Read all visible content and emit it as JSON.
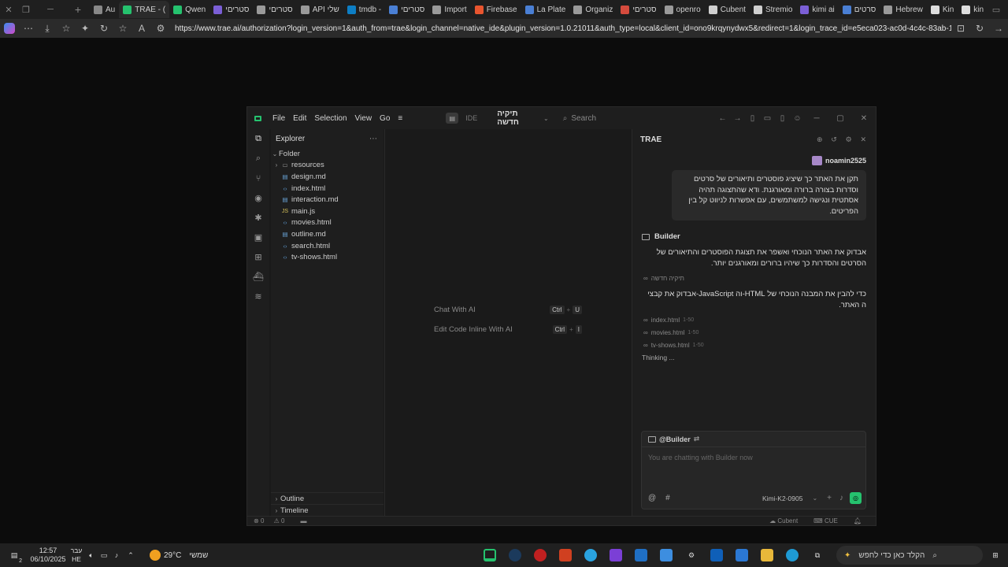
{
  "browser": {
    "tabs": [
      {
        "label": "Au",
        "color": "#888888"
      },
      {
        "label": "TRAE - (",
        "color": "#25c26e"
      },
      {
        "label": "Qwen",
        "color": "#25c26e"
      },
      {
        "label": "סטריםי",
        "color": "#7b5fd6"
      },
      {
        "label": "סטריםי",
        "color": "#9a9a9a"
      },
      {
        "label": "API שלי",
        "color": "#9a9a9a"
      },
      {
        "label": "tmdb - ",
        "color": "#0d7ec4"
      },
      {
        "label": "סטריםי",
        "color": "#4a7fd4"
      },
      {
        "label": "Import",
        "color": "#9a9a9a"
      },
      {
        "label": "Firebase",
        "color": "#e9552f"
      },
      {
        "label": "La Plate",
        "color": "#4a7fd4"
      },
      {
        "label": "Organiz",
        "color": "#9a9a9a"
      },
      {
        "label": "סטריםי",
        "color": "#d54b3d"
      },
      {
        "label": "openro",
        "color": "#9a9a9a"
      },
      {
        "label": "Cubent",
        "color": "#cfcfcf"
      },
      {
        "label": "Stremio",
        "color": "#cfcfcf"
      },
      {
        "label": "kimi ai",
        "color": "#7b5fd6"
      },
      {
        "label": "סרטים",
        "color": "#4a7fd4"
      },
      {
        "label": "Hebrew",
        "color": "#9a9a9a"
      },
      {
        "label": "Kin",
        "color": "#dddddd"
      },
      {
        "label": "kin",
        "color": "#dddddd"
      }
    ],
    "url": "https://www.trae.ai/authorization?login_version=1&auth_from=trae&login_channel=native_ide&plugin_version=1.0.21011&auth_type=local&client_id=ono9krqynydwx5&redirect=1&login_trace_id=e5eca023-ac0d-4c4c-83ab-163708fe6f..."
  },
  "ide": {
    "menus": [
      "File",
      "Edit",
      "Selection",
      "View",
      "Go"
    ],
    "mode_label": "IDE",
    "folder_title": "תיקיה חדשה",
    "search_placeholder": "Search",
    "explorer": {
      "title": "Explorer",
      "root": "Folder",
      "items": [
        {
          "name": "resources",
          "type": "folder"
        },
        {
          "name": "design.md",
          "type": "md"
        },
        {
          "name": "index.html",
          "type": "html"
        },
        {
          "name": "interaction.md",
          "type": "md"
        },
        {
          "name": "main.js",
          "type": "js"
        },
        {
          "name": "movies.html",
          "type": "html"
        },
        {
          "name": "outline.md",
          "type": "md"
        },
        {
          "name": "search.html",
          "type": "html"
        },
        {
          "name": "tv-shows.html",
          "type": "html"
        }
      ],
      "outline": "Outline",
      "timeline": "Timeline"
    },
    "editor": {
      "hint1": "Chat With AI",
      "hint1_keys": [
        "Ctrl",
        "U"
      ],
      "hint2": "Edit Code Inline With AI",
      "hint2_keys": [
        "Ctrl",
        "I"
      ]
    },
    "chat": {
      "title": "TRAE",
      "username": "noamin2525",
      "user_message": "תקן את האתר כך שיציג פוסטרים ותיאורים של סרטים וסדרות בצורה ברורה ומאורגנת. ודא שהתצוגה תהיה אסתטית ונגישה למשתמשים, עם אפשרות לניווט קל בין הפריטים.",
      "agent_name": "Builder",
      "agent_text1": "אבדוק את האתר הנוכחי ואשפר את תצוגת הפוסטרים והתיאורים של הסרטים והסדרות כך שיהיו ברורים ומאורגנים יותר.",
      "ref_folder": "תיקיה חדשה",
      "agent_text2": "כדי להבין את המבנה הנוכחי של HTML-וה JavaScript-אבדוק את קבצי ה האתר.",
      "refs": [
        {
          "file": "index.html",
          "lines": "1-50"
        },
        {
          "file": "movies.html",
          "lines": "1-50"
        },
        {
          "file": "tv-shows.html",
          "lines": "1-50"
        }
      ],
      "status": "Thinking ...",
      "composer_tag": "@Builder",
      "composer_placeholder": "You are chatting with Builder now",
      "model": "Kimi-K2-0905",
      "at_symbol": "@",
      "hash_symbol": "#"
    },
    "statusbar": {
      "errors": "0",
      "warnings": "0",
      "right1": "Cubent",
      "right2": "CUE"
    }
  },
  "taskbar": {
    "time": "12:57",
    "date": "06/10/2025",
    "lang_top": "עבר",
    "lang_bottom": "HE",
    "temp": "29°C",
    "weather_label": "שמשי",
    "search_placeholder": "הקלד כאן כדי לחפש",
    "notification_count": "2"
  },
  "colors": {
    "accent": "#25c26e",
    "background": "#1e1e1e"
  }
}
